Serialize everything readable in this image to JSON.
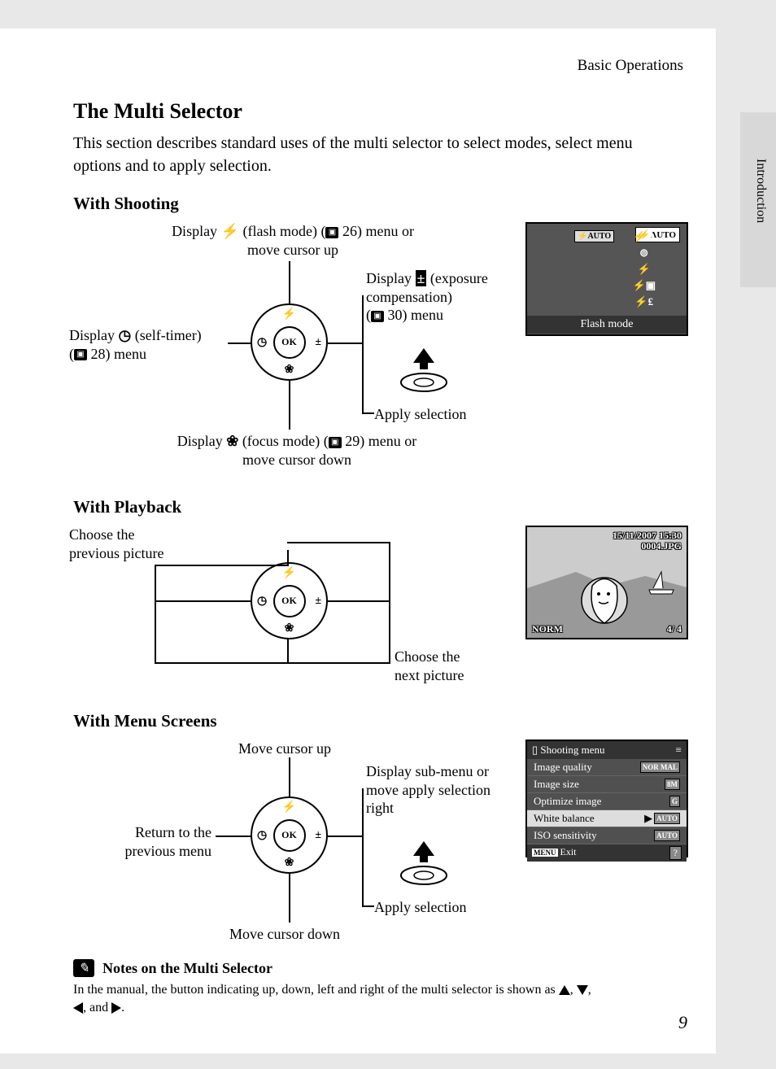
{
  "header": {
    "chapter": "Basic Operations"
  },
  "side_tab": "Introduction",
  "title": "The Multi Selector",
  "intro": "This section describes standard uses of the multi selector to select modes, select menu options and to apply selection.",
  "sections": {
    "shooting": {
      "heading": "With Shooting",
      "up_pre": "Display ",
      "up_mid": " (flash mode) (",
      "up_pageref": "26",
      "up_post": ") menu or move cursor up",
      "left_pre": "Display ",
      "left_mid": " (self-timer) (",
      "left_pageref": "28",
      "left_post": ") menu",
      "right_pre": "Display ",
      "right_mid": " (exposure compensation) (",
      "right_pageref": "30",
      "right_post": ") menu",
      "down_pre": "Display ",
      "down_mid": " (focus mode) (",
      "down_pageref": "29",
      "down_post": ") menu or move cursor down",
      "apply": "Apply selection"
    },
    "playback": {
      "heading": "With Playback",
      "prev": "Choose the previous picture",
      "next": "Choose the next picture"
    },
    "menus": {
      "heading": "With Menu Screens",
      "up": "Move cursor up",
      "down": "Move cursor down",
      "left": "Return to the previous menu",
      "right": "Display sub-menu or move apply selection right",
      "apply": "Apply selection"
    }
  },
  "selector": {
    "ok": "OK",
    "flash": "⚡",
    "macro": "❀",
    "timer": "◷",
    "exp": "±"
  },
  "flash_screen": {
    "caption": "Flash mode",
    "auto1": "⚡AUTO",
    "auto2": "⚡AUTO"
  },
  "playback_screen": {
    "date": "15/11/2007 15:30",
    "file": "0004.JPG",
    "left_info": "NORM",
    "count": "4/      4"
  },
  "menu_screen": {
    "title": "Shooting menu",
    "items": [
      {
        "label": "Image quality",
        "badge": "NOR MAL",
        "selected": false
      },
      {
        "label": "Image size",
        "badge": "8M",
        "selected": false
      },
      {
        "label": "Optimize image",
        "badge": "G",
        "selected": false
      },
      {
        "label": "White balance",
        "badge": "AUTO",
        "selected": true
      },
      {
        "label": "ISO sensitivity",
        "badge": "AUTO",
        "selected": false
      }
    ],
    "exit_label": "MENU",
    "exit_text": "Exit",
    "help": "?"
  },
  "notes": {
    "title": "Notes on the Multi Selector",
    "body_pre": "In the manual, the button indicating up, down, left and right of the multi selector is shown as ",
    "body_post": "."
  },
  "page_number": "9"
}
